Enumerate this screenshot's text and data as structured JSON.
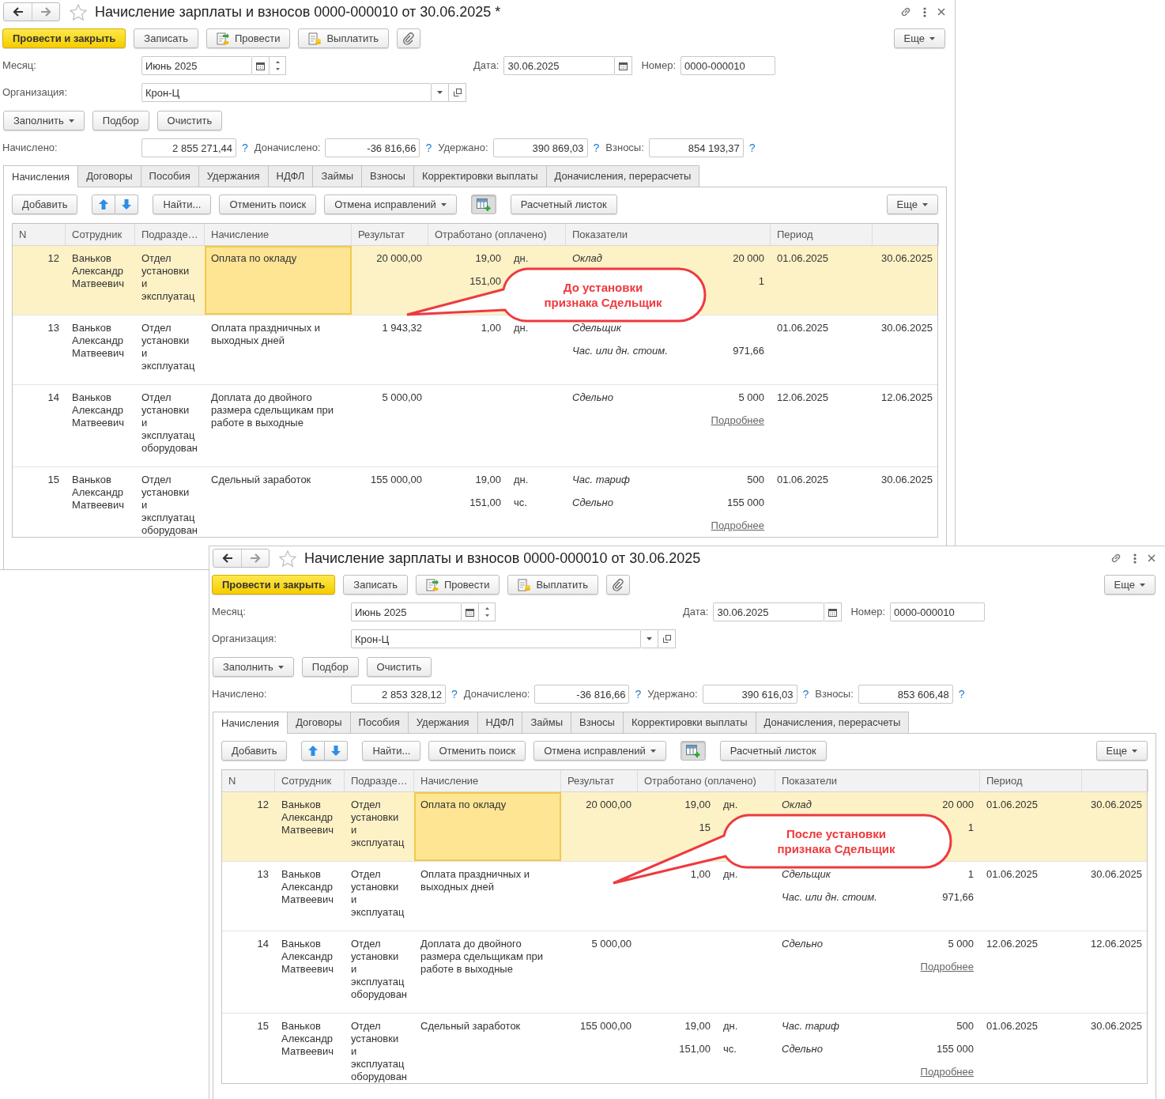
{
  "windows": [
    {
      "title": "Начисление зарплаты и взносов 0000-000010 от 30.06.2025 *",
      "toolbar": [
        {
          "kind": "primary",
          "label": "Провести и закрыть"
        },
        {
          "kind": "plain",
          "label": "Записать"
        },
        {
          "kind": "post",
          "label": "Провести"
        },
        {
          "kind": "pay",
          "label": "Выплатить"
        },
        {
          "kind": "attach"
        }
      ],
      "more": "Еще",
      "month": {
        "label": "Месяц:",
        "value": "Июнь 2025"
      },
      "date": {
        "label": "Дата:",
        "value": "30.06.2025"
      },
      "number": {
        "label": "Номер:",
        "value": "0000-000010"
      },
      "organization": {
        "label": "Организация:",
        "value": "Крон-Ц"
      },
      "fill_buttons": [
        {
          "label": "Заполнить",
          "dropdown": true
        },
        {
          "label": "Подбор",
          "dropdown": false
        },
        {
          "label": "Очистить",
          "dropdown": false
        }
      ],
      "totals": [
        {
          "label": "Начислено:",
          "value": "2 855 271,44",
          "help": "?"
        },
        {
          "label": "Доначислено:",
          "value": "-36 816,66",
          "help": "?"
        },
        {
          "label": "Удержано:",
          "value": "390 869,03",
          "help": "?"
        },
        {
          "label": "Взносы:",
          "value": "854 193,37",
          "help": "?"
        }
      ],
      "tabs": [
        {
          "label": "Начисления",
          "selected": true
        },
        {
          "label": "Договоры",
          "selected": false
        },
        {
          "label": "Пособия",
          "selected": false
        },
        {
          "label": "Удержания",
          "selected": false
        },
        {
          "label": "НДФЛ",
          "selected": false
        },
        {
          "label": "Займы",
          "selected": false
        },
        {
          "label": "Взносы",
          "selected": false
        },
        {
          "label": "Корректировки выплаты",
          "selected": false
        },
        {
          "label": "Доначисления, перерасчеты",
          "selected": false
        }
      ],
      "table_toolbar": [
        {
          "kind": "text",
          "label": "Добавить",
          "dropdown": false
        },
        {
          "kind": "updown"
        },
        {
          "kind": "text",
          "label": "Найти...",
          "dropdown": false
        },
        {
          "kind": "text",
          "label": "Отменить поиск",
          "dropdown": false
        },
        {
          "kind": "text",
          "label": "Отмена исправлений",
          "dropdown": true
        },
        {
          "kind": "settings"
        },
        {
          "kind": "text",
          "label": "Расчетный листок",
          "dropdown": false
        }
      ],
      "table_more": "Еще",
      "columns": [
        "N",
        "Сотрудник",
        "Подразде…",
        "Начисление",
        "Результат",
        "Отработано (оплачено)",
        "Показатели",
        "Период"
      ],
      "rows": [
        {
          "n": "12",
          "employee": [
            "Ваньков",
            "Александр",
            "Матвеевич"
          ],
          "department": [
            "Отдел",
            "установки",
            "и",
            "эксплуатац"
          ],
          "accrual": "Оплата по окладу",
          "result": "20 000,00",
          "worked": [
            {
              "value": "19,00",
              "unit": "дн."
            },
            {
              "value": "151,00"
            }
          ],
          "indicators": [
            {
              "name": "Оклад",
              "value": "20 000"
            },
            {
              "value": "1"
            }
          ],
          "period_start": "01.06.2025",
          "period_end": "30.06.2025",
          "selected": true
        },
        {
          "n": "13",
          "employee": [
            "Ваньков",
            "Александр",
            "Матвеевич"
          ],
          "department": [
            "Отдел",
            "установки",
            "и",
            "эксплуатац"
          ],
          "accrual": "Оплата праздничных и выходных дней",
          "result": "1 943,32",
          "worked": [
            {
              "value": "1,00",
              "unit": "дн."
            }
          ],
          "indicators": [
            {
              "name": "Сдельщик"
            },
            {
              "name": "Час. или дн. стоим.",
              "value": "971,66"
            }
          ],
          "period_start": "01.06.2025",
          "period_end": "30.06.2025",
          "selected": false
        },
        {
          "n": "14",
          "employee": [
            "Ваньков",
            "Александр",
            "Матвеевич"
          ],
          "department": [
            "Отдел",
            "установки",
            "и",
            "эксплуатац",
            "оборудован"
          ],
          "accrual": "Доплата до двойного размера сдельщикам при работе в выходные",
          "result": "5 000,00",
          "indicators": [
            {
              "name": "Сдельно",
              "value": "5 000"
            }
          ],
          "link": "Подробнее",
          "period_start": "12.06.2025",
          "period_end": "12.06.2025",
          "selected": false
        },
        {
          "n": "15",
          "employee": [
            "Ваньков",
            "Александр",
            "Матвеевич"
          ],
          "department": [
            "Отдел",
            "установки",
            "и",
            "эксплуатац",
            "оборудован"
          ],
          "accrual": "Сдельный заработок",
          "result": "155 000,00",
          "worked": [
            {
              "value": "19,00",
              "unit": "дн."
            },
            {
              "value": "151,00",
              "unit": "чс."
            }
          ],
          "indicators": [
            {
              "name": "Час. тариф",
              "value": "500"
            },
            {
              "name": "Сдельно",
              "value": "155 000"
            }
          ],
          "link": "Подробнее",
          "period_start": "01.06.2025",
          "period_end": "30.06.2025",
          "selected": false
        }
      ],
      "callout": [
        "До установки",
        "признака Сдельщик"
      ]
    },
    {
      "title": "Начисление зарплаты и взносов 0000-000010 от 30.06.2025",
      "toolbar": [
        {
          "kind": "primary",
          "label": "Провести и закрыть"
        },
        {
          "kind": "plain",
          "label": "Записать"
        },
        {
          "kind": "post",
          "label": "Провести"
        },
        {
          "kind": "pay",
          "label": "Выплатить"
        },
        {
          "kind": "attach"
        }
      ],
      "more": "Еще",
      "month": {
        "label": "Месяц:",
        "value": "Июнь 2025"
      },
      "date": {
        "label": "Дата:",
        "value": "30.06.2025"
      },
      "number": {
        "label": "Номер:",
        "value": "0000-000010"
      },
      "organization": {
        "label": "Организация:",
        "value": "Крон-Ц"
      },
      "fill_buttons": [
        {
          "label": "Заполнить",
          "dropdown": true
        },
        {
          "label": "Подбор",
          "dropdown": false
        },
        {
          "label": "Очистить",
          "dropdown": false
        }
      ],
      "totals": [
        {
          "label": "Начислено:",
          "value": "2 853 328,12",
          "help": "?"
        },
        {
          "label": "Доначислено:",
          "value": "-36 816,66",
          "help": "?"
        },
        {
          "label": "Удержано:",
          "value": "390 616,03",
          "help": "?"
        },
        {
          "label": "Взносы:",
          "value": "853 606,48",
          "help": "?"
        }
      ],
      "tabs": [
        {
          "label": "Начисления",
          "selected": true
        },
        {
          "label": "Договоры",
          "selected": false
        },
        {
          "label": "Пособия",
          "selected": false
        },
        {
          "label": "Удержания",
          "selected": false
        },
        {
          "label": "НДФЛ",
          "selected": false
        },
        {
          "label": "Займы",
          "selected": false
        },
        {
          "label": "Взносы",
          "selected": false
        },
        {
          "label": "Корректировки выплаты",
          "selected": false
        },
        {
          "label": "Доначисления, перерасчеты",
          "selected": false
        }
      ],
      "table_toolbar": [
        {
          "kind": "text",
          "label": "Добавить",
          "dropdown": false
        },
        {
          "kind": "updown"
        },
        {
          "kind": "text",
          "label": "Найти...",
          "dropdown": false
        },
        {
          "kind": "text",
          "label": "Отменить поиск",
          "dropdown": false
        },
        {
          "kind": "text",
          "label": "Отмена исправлений",
          "dropdown": true
        },
        {
          "kind": "settings"
        },
        {
          "kind": "text",
          "label": "Расчетный листок",
          "dropdown": false
        }
      ],
      "table_more": "Еще",
      "columns": [
        "N",
        "Сотрудник",
        "Подразде…",
        "Начисление",
        "Результат",
        "Отработано (оплачено)",
        "Показатели",
        "Период"
      ],
      "rows": [
        {
          "n": "12",
          "employee": [
            "Ваньков",
            "Александр",
            "Матвеевич"
          ],
          "department": [
            "Отдел",
            "установки",
            "и",
            "эксплуатац"
          ],
          "accrual": "Оплата по окладу",
          "result": "20 000,00",
          "worked": [
            {
              "value": "19,00",
              "unit": "дн."
            },
            {
              "value": "15"
            }
          ],
          "indicators": [
            {
              "name": "Оклад",
              "value": "20 000"
            },
            {
              "value": "1"
            }
          ],
          "period_start": "01.06.2025",
          "period_end": "30.06.2025",
          "selected": true
        },
        {
          "n": "13",
          "employee": [
            "Ваньков",
            "Александр",
            "Матвеевич"
          ],
          "department": [
            "Отдел",
            "установки",
            "и",
            "эксплуатац"
          ],
          "accrual": "Оплата праздничных и выходных дней",
          "worked": [
            {
              "value": "1,00",
              "unit": "дн."
            }
          ],
          "indicators": [
            {
              "name": "Сдельщик",
              "value": "1"
            },
            {
              "name": "Час. или дн. стоим.",
              "value": "971,66"
            }
          ],
          "period_start": "01.06.2025",
          "period_end": "30.06.2025",
          "selected": false
        },
        {
          "n": "14",
          "employee": [
            "Ваньков",
            "Александр",
            "Матвеевич"
          ],
          "department": [
            "Отдел",
            "установки",
            "и",
            "эксплуатац",
            "оборудован"
          ],
          "accrual": "Доплата до двойного размера сдельщикам при работе в выходные",
          "result": "5 000,00",
          "indicators": [
            {
              "name": "Сдельно",
              "value": "5 000"
            }
          ],
          "link": "Подробнее",
          "period_start": "12.06.2025",
          "period_end": "12.06.2025",
          "selected": false
        },
        {
          "n": "15",
          "employee": [
            "Ваньков",
            "Александр",
            "Матвеевич"
          ],
          "department": [
            "Отдел",
            "установки",
            "и",
            "эксплуатац",
            "оборудован"
          ],
          "accrual": "Сдельный заработок",
          "result": "155 000,00",
          "worked": [
            {
              "value": "19,00",
              "unit": "дн."
            },
            {
              "value": "151,00",
              "unit": "чс."
            }
          ],
          "indicators": [
            {
              "name": "Час. тариф",
              "value": "500"
            },
            {
              "name": "Сдельно",
              "value": "155 000"
            }
          ],
          "link": "Подробнее",
          "period_start": "01.06.2025",
          "period_end": "30.06.2025",
          "selected": false
        }
      ],
      "callout": [
        "После установки",
        "признака Сдельщик"
      ]
    }
  ]
}
